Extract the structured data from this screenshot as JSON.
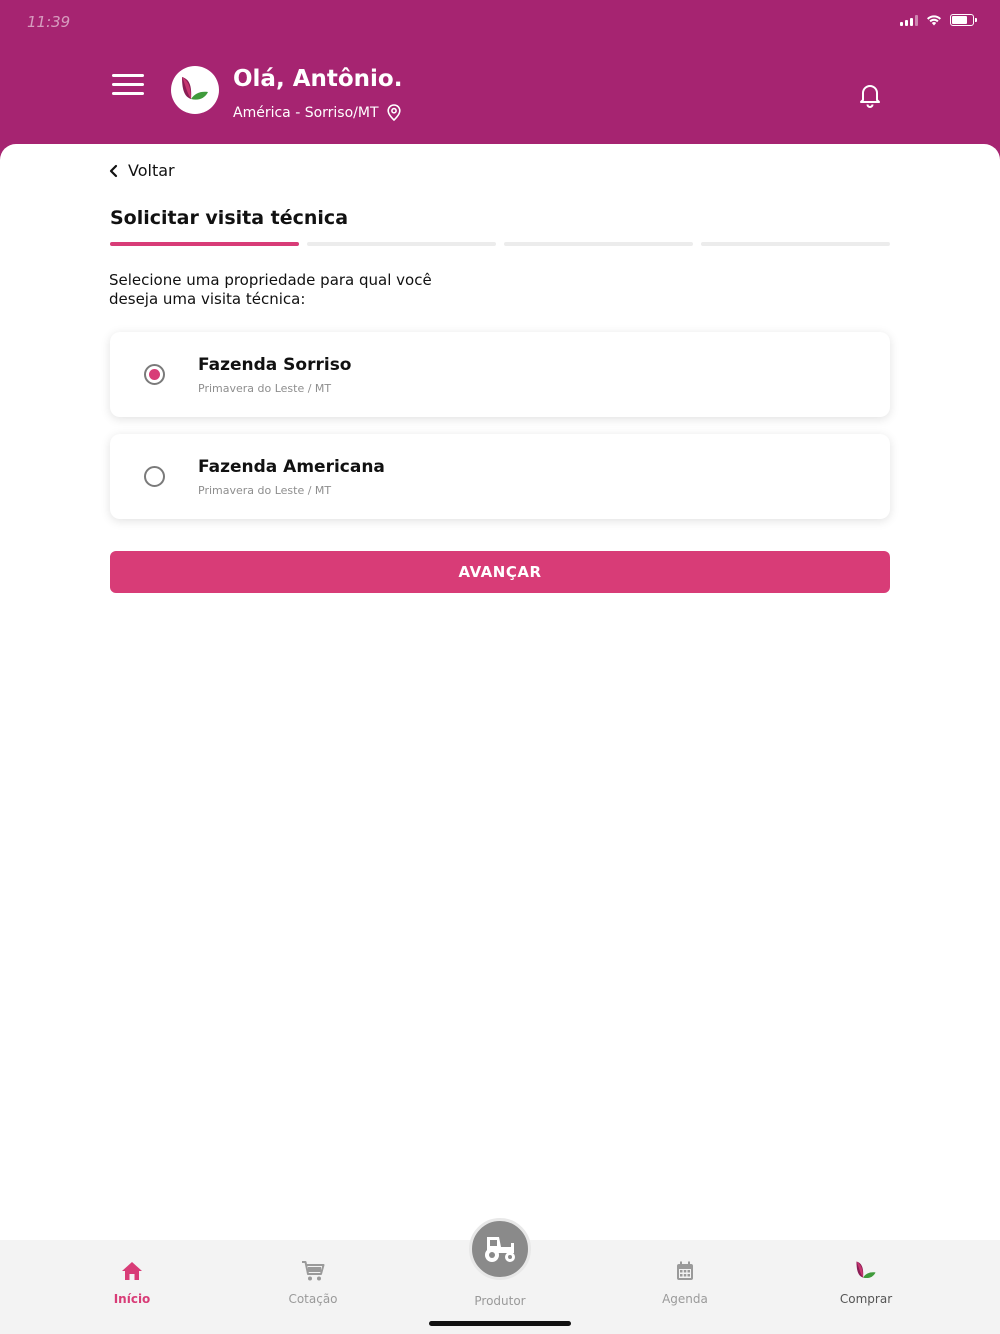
{
  "status_bar": {
    "time": "11:39"
  },
  "header": {
    "greeting": "Olá, Antônio.",
    "location": "América - Sorriso/MT"
  },
  "page": {
    "back_label": "Voltar",
    "title": "Solicitar visita técnica",
    "instruction": "Selecione uma propriedade para qual você deseja uma visita técnica:",
    "steps_total": 4,
    "steps_current": 1,
    "properties": [
      {
        "name": "Fazenda Sorriso",
        "location": "Primavera do Leste / MT",
        "selected": true
      },
      {
        "name": "Fazenda Americana",
        "location": "Primavera do Leste / MT",
        "selected": false
      }
    ],
    "advance_label": "AVANÇAR"
  },
  "tabbar": {
    "items": [
      {
        "label": "Início",
        "icon": "home-icon",
        "active": true
      },
      {
        "label": "Cotação",
        "icon": "cart-icon",
        "active": false
      },
      {
        "label": "Produtor",
        "icon": "tractor-icon",
        "active": false
      },
      {
        "label": "Agenda",
        "icon": "calendar-icon",
        "active": false
      },
      {
        "label": "Comprar",
        "icon": "brand-logo-icon",
        "active": false
      }
    ]
  },
  "colors": {
    "header": "#a62471",
    "accent": "#d83c77",
    "tabbar": "#f3f3f3"
  }
}
